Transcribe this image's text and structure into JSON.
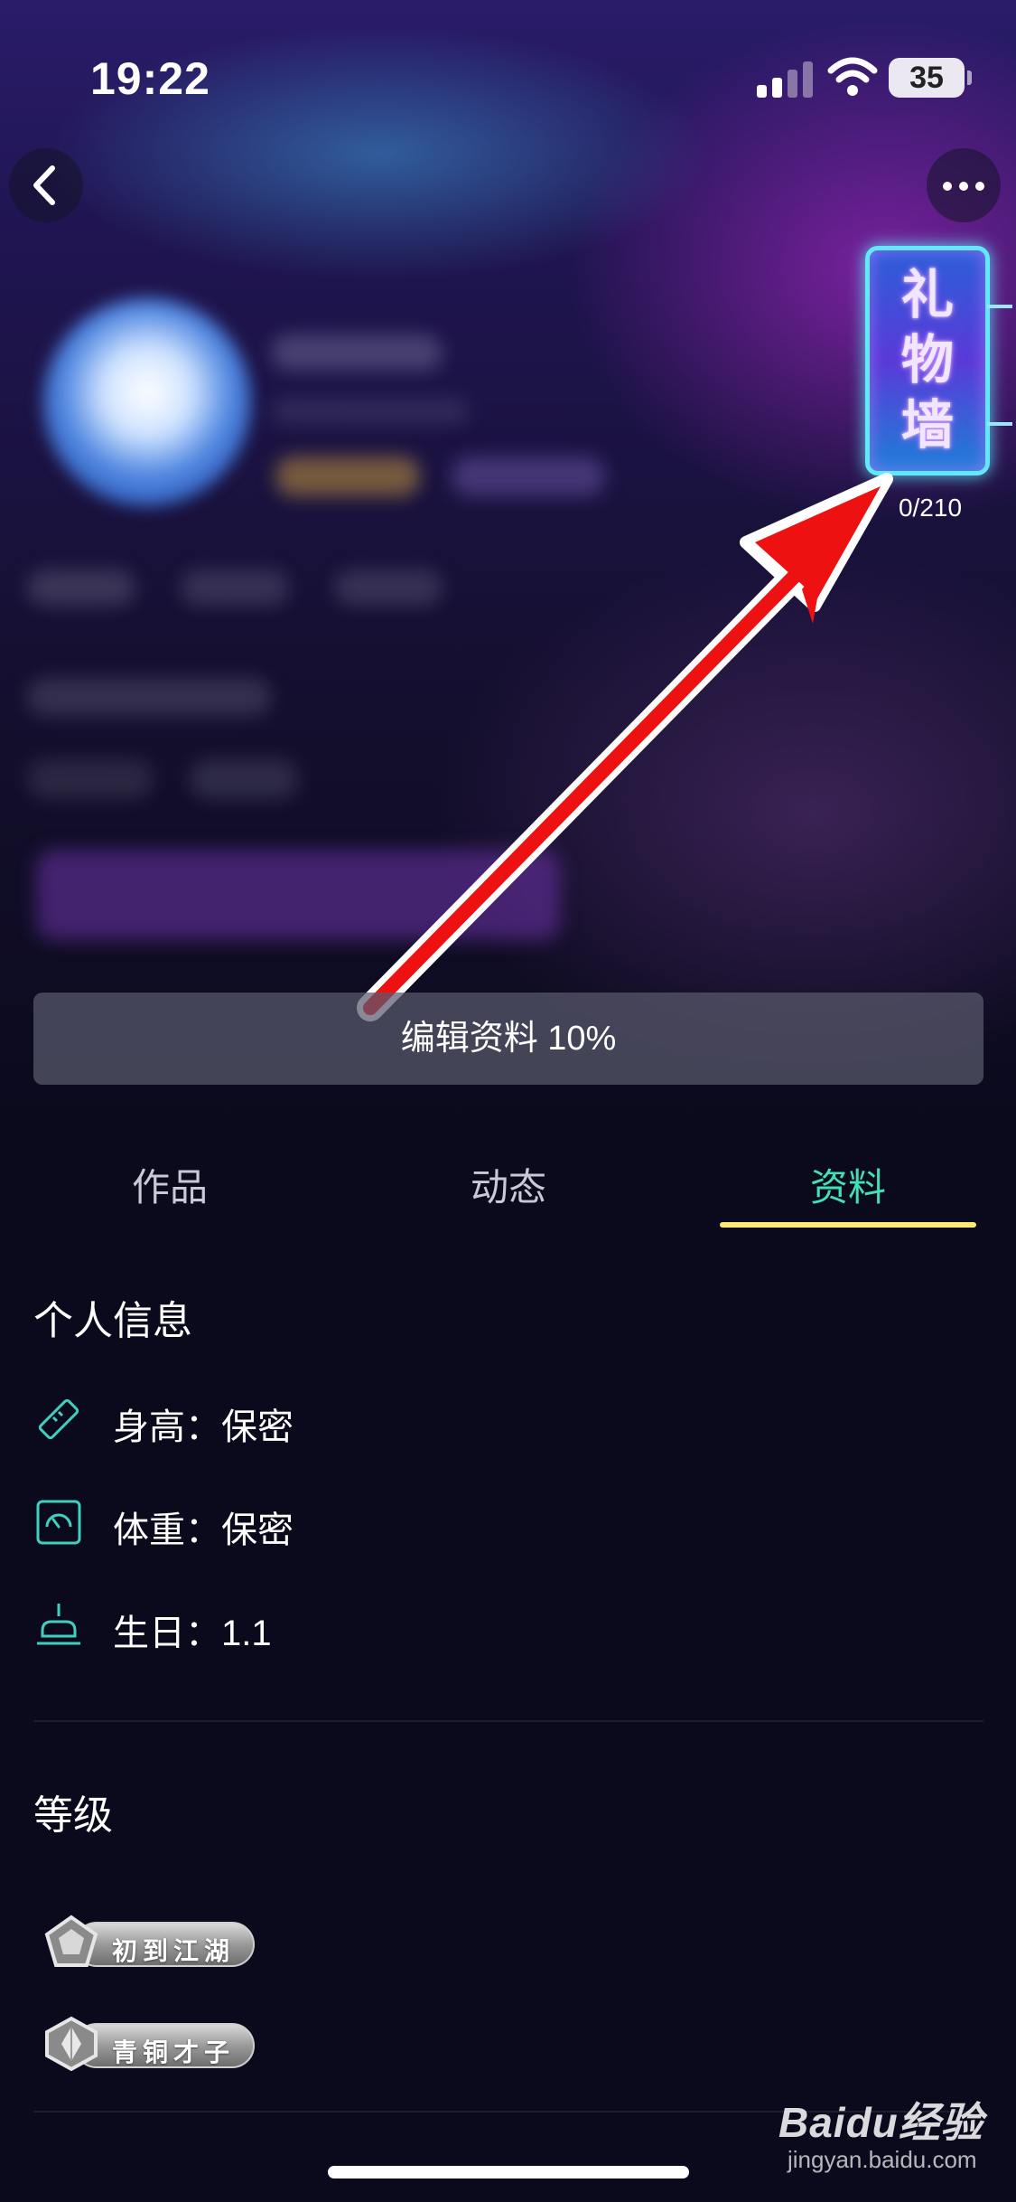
{
  "status_bar": {
    "time": "19:22",
    "battery": "35"
  },
  "gift_wall": {
    "chars": [
      "礼",
      "物",
      "墙"
    ],
    "count": "0/210"
  },
  "edit_profile": {
    "label": "编辑资料 10%"
  },
  "tabs": [
    {
      "label": "作品",
      "active": false
    },
    {
      "label": "动态",
      "active": false
    },
    {
      "label": "资料",
      "active": true
    }
  ],
  "personal_info": {
    "title": "个人信息",
    "rows": [
      {
        "icon": "ruler-icon",
        "text": "身高：保密"
      },
      {
        "icon": "scale-icon",
        "text": "体重：保密"
      },
      {
        "icon": "cake-icon",
        "text": "生日：1.1"
      }
    ]
  },
  "level": {
    "title": "等级",
    "badges": [
      {
        "icon": "pentagon-badge-icon",
        "label": "初到江湖"
      },
      {
        "icon": "diamond-badge-icon",
        "label": "青铜才子"
      }
    ]
  },
  "watermark": {
    "logo": "Baidu经验",
    "url": "jingyan.baidu.com"
  },
  "colors": {
    "accent_tab": "#42e0b7",
    "tab_underline": "#ffe874",
    "arrow": "#ee1111"
  }
}
